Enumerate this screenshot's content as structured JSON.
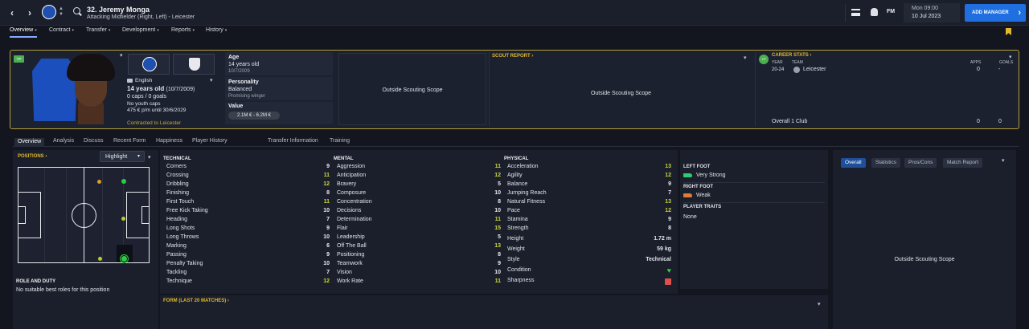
{
  "topbar": {
    "player_title": "32. Jeremy Monga",
    "player_subtitle": "Attacking Midfielder (Right, Left) - Leicester",
    "fm_label": "FM",
    "date_line1": "Mon 09:00",
    "date_line2": "10 Jul 2023",
    "add_manager": "ADD MANAGER"
  },
  "main_tabs": [
    "Overview",
    "Contract",
    "Transfer",
    "Development",
    "Reports",
    "History"
  ],
  "header": {
    "wonderkid_badge": "YP",
    "nationality": "English",
    "age_line": "14 years old",
    "dob_paren": "(10/7/2009)",
    "caps": "0 caps / 0 goals",
    "youth_caps": "No youth caps",
    "wage": "475 € p/m until 30/6/2029",
    "contract": "Contracted to Leicester",
    "age_label": "Age",
    "age_value": "14 years old",
    "age_dob": "10/7/2009",
    "personality_label": "Personality",
    "personality_value": "Balanced",
    "personality_sub": "Promising winger",
    "value_label": "Value",
    "value_range": "2.1M € - 6.2M €",
    "oss_left": "Outside Scouting Scope",
    "scout_report_title": "SCOUT REPORT",
    "oss_scout": "Outside Scouting Scope",
    "career_title": "CAREER STATS",
    "career_badge": "YP",
    "col_year": "YEAR",
    "col_team": "TEAM",
    "col_apps": "APPS",
    "col_goals": "GOALS",
    "career_year": "20-24",
    "career_team": "Leicester",
    "career_apps": "0",
    "career_goals": "-",
    "overall_label": "Overall 1 Club",
    "overall_apps": "0",
    "overall_goals": "0"
  },
  "sub_tabs": [
    "Overview",
    "Analysis",
    "Discuss",
    "Recent Form",
    "Happiness",
    "Player History",
    "Transfer Information",
    "Training"
  ],
  "positions": {
    "title": "POSITIONS",
    "highlight": "Highlight",
    "role_title": "ROLE AND DUTY",
    "role_text": "No suitable best roles for this position"
  },
  "technical": {
    "title": "TECHNICAL",
    "rows": [
      {
        "name": "Corners",
        "value": "9"
      },
      {
        "name": "Crossing",
        "value": "11"
      },
      {
        "name": "Dribbling",
        "value": "12"
      },
      {
        "name": "Finishing",
        "value": "8"
      },
      {
        "name": "First Touch",
        "value": "11"
      },
      {
        "name": "Free Kick Taking",
        "value": "10"
      },
      {
        "name": "Heading",
        "value": "7"
      },
      {
        "name": "Long Shots",
        "value": "9"
      },
      {
        "name": "Long Throws",
        "value": "10"
      },
      {
        "name": "Marking",
        "value": "6"
      },
      {
        "name": "Passing",
        "value": "9"
      },
      {
        "name": "Penalty Taking",
        "value": "10"
      },
      {
        "name": "Tackling",
        "value": "7"
      },
      {
        "name": "Technique",
        "value": "12"
      }
    ]
  },
  "mental": {
    "title": "MENTAL",
    "rows": [
      {
        "name": "Aggression",
        "value": "11"
      },
      {
        "name": "Anticipation",
        "value": "12"
      },
      {
        "name": "Bravery",
        "value": "5"
      },
      {
        "name": "Composure",
        "value": "10"
      },
      {
        "name": "Concentration",
        "value": "8"
      },
      {
        "name": "Decisions",
        "value": "10"
      },
      {
        "name": "Determination",
        "value": "11"
      },
      {
        "name": "Flair",
        "value": "15"
      },
      {
        "name": "Leadership",
        "value": "5"
      },
      {
        "name": "Off The Ball",
        "value": "13"
      },
      {
        "name": "Positioning",
        "value": "8"
      },
      {
        "name": "Teamwork",
        "value": "9"
      },
      {
        "name": "Vision",
        "value": "10"
      },
      {
        "name": "Work Rate",
        "value": "11"
      }
    ]
  },
  "physical": {
    "title": "PHYSICAL",
    "rows": [
      {
        "name": "Acceleration",
        "value": "13"
      },
      {
        "name": "Agility",
        "value": "12"
      },
      {
        "name": "Balance",
        "value": "9"
      },
      {
        "name": "Jumping Reach",
        "value": "7"
      },
      {
        "name": "Natural Fitness",
        "value": "13"
      },
      {
        "name": "Pace",
        "value": "12"
      },
      {
        "name": "Stamina",
        "value": "9"
      },
      {
        "name": "Strength",
        "value": "8"
      }
    ],
    "height_label": "Height",
    "height": "1.72 m",
    "weight_label": "Weight",
    "weight": "59 kg",
    "style_label": "Style",
    "style": "Technical",
    "condition_label": "Condition",
    "sharpness_label": "Sharpness"
  },
  "feet": {
    "left_title": "LEFT FOOT",
    "left_value": "Very Strong",
    "right_title": "RIGHT FOOT",
    "right_value": "Weak",
    "traits_title": "PLAYER TRAITS",
    "traits_value": "None"
  },
  "right_panel": {
    "tabs": [
      "Overall",
      "Statistics",
      "Pros/Cons",
      "Match Report"
    ],
    "oss": "Outside Scouting Scope"
  },
  "form": {
    "title": "FORM (LAST 20 MATCHES)"
  },
  "colors": {
    "accent_gold": "#e0b92c",
    "high_attr": "#c8d341",
    "green": "#2ecc40",
    "add_manager": "#1f6fe0"
  }
}
